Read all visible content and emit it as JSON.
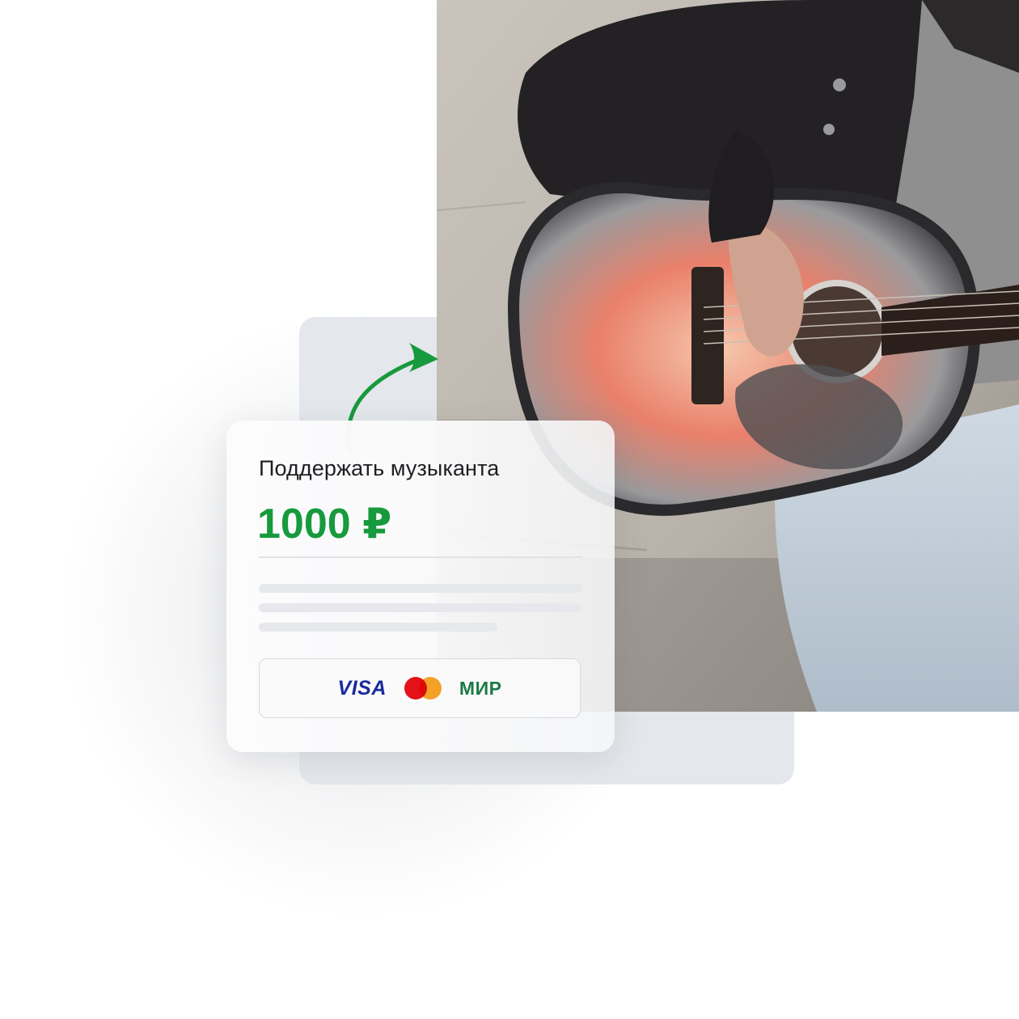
{
  "donation": {
    "title": "Поддержать музыканта",
    "amount": "1000 ₽"
  },
  "payment_methods": {
    "visa": "VISA",
    "mastercard": "mastercard-logo",
    "mir": "МИР"
  },
  "colors": {
    "accent_green": "#179a3d",
    "visa_blue": "#1a2a9e",
    "mir_green": "#1c7a44"
  },
  "icons": {
    "arrow": "curved-arrow-icon"
  }
}
